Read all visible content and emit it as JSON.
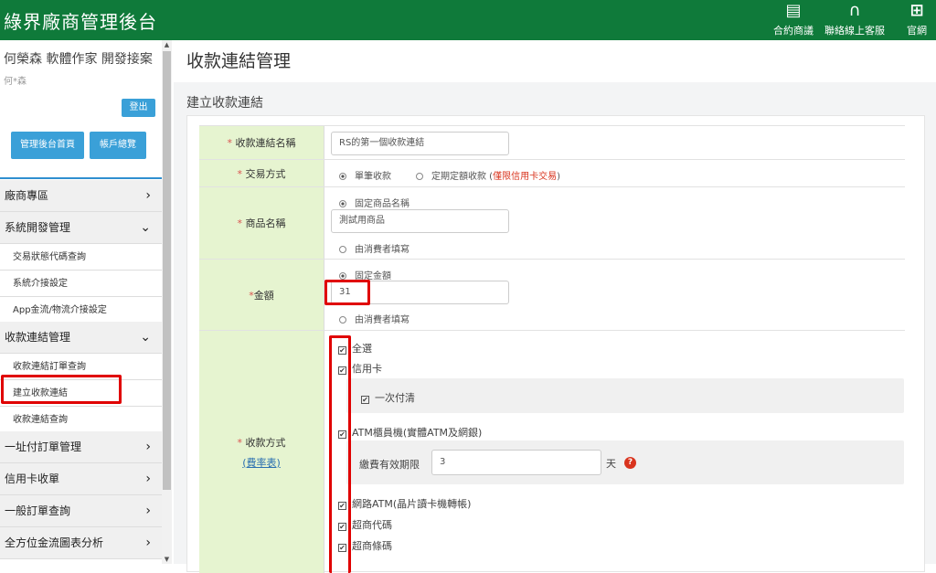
{
  "app": {
    "title": "綠界廠商管理後台"
  },
  "topnav": [
    {
      "label": "合約商議",
      "icon": "contract-icon"
    },
    {
      "label": "聯絡線上客服",
      "icon": "headset-icon"
    },
    {
      "label": "官網",
      "icon": "ecpay-logo-icon"
    }
  ],
  "user": {
    "name": "何榮森 軟體作家 開發接案",
    "sub": "何*森",
    "logout": "登出",
    "home_btn": "管理後台首頁",
    "account_btn": "帳戶總覽"
  },
  "sidebar": {
    "items": [
      {
        "label": "廠商專區",
        "chevron": "›"
      },
      {
        "label": "系統開發管理",
        "chevron": "⌄"
      },
      {
        "label": "交易狀態代碼查詢"
      },
      {
        "label": "系統介接設定"
      },
      {
        "label": "App金流/物流介接設定"
      },
      {
        "label": "收款連結管理",
        "chevron": "⌄"
      },
      {
        "label": "收款連結訂單查詢"
      },
      {
        "label": "建立收款連結"
      },
      {
        "label": "收款連結查詢"
      },
      {
        "label": "一址付訂單管理",
        "chevron": "›"
      },
      {
        "label": "信用卡收單",
        "chevron": "›"
      },
      {
        "label": "一般訂單查詢",
        "chevron": "›"
      },
      {
        "label": "全方位金流圖表分析",
        "chevron": "›"
      }
    ]
  },
  "page": {
    "title": "收款連結管理",
    "section": "建立收款連結"
  },
  "form": {
    "req_mark": "*",
    "name_label": "收款連結名稱",
    "name_value": "RS的第一個收款連結",
    "trade_label": "交易方式",
    "trade_single": "單筆收款",
    "trade_period": "定期定額收款",
    "trade_note_open": " (",
    "trade_note": "僅限信用卡交易",
    "trade_note_close": ")",
    "product_label": "商品名稱",
    "product_fixed": "固定商品名稱",
    "product_value": "測試用商品",
    "product_consumer": "由消費者填寫",
    "amount_label": "金額",
    "amount_fixed": "固定金額",
    "amount_value": "31",
    "amount_consumer": "由消費者填寫",
    "pay_label": "收款方式",
    "pay_link": "(費率表)",
    "check_mark": "✔",
    "pay_all": "全選",
    "pay_credit": "信用卡",
    "pay_credit_once": "一次付清",
    "pay_atm": "ATM櫃員機(實體ATM及網銀)",
    "pay_deadline_label": "繳費有效期限",
    "pay_deadline_value": "3",
    "pay_deadline_unit": "天",
    "help_glyph": "?",
    "pay_webatm": "網路ATM(晶片讀卡機轉帳)",
    "pay_cvs_code": "超商代碼",
    "pay_cvs_barcode": "超商條碼"
  },
  "colors": {
    "topbar": "#0f7a3a",
    "label_bg": "#e6f4d0",
    "highlight": "#e00000",
    "button": "#3aa0d8"
  }
}
